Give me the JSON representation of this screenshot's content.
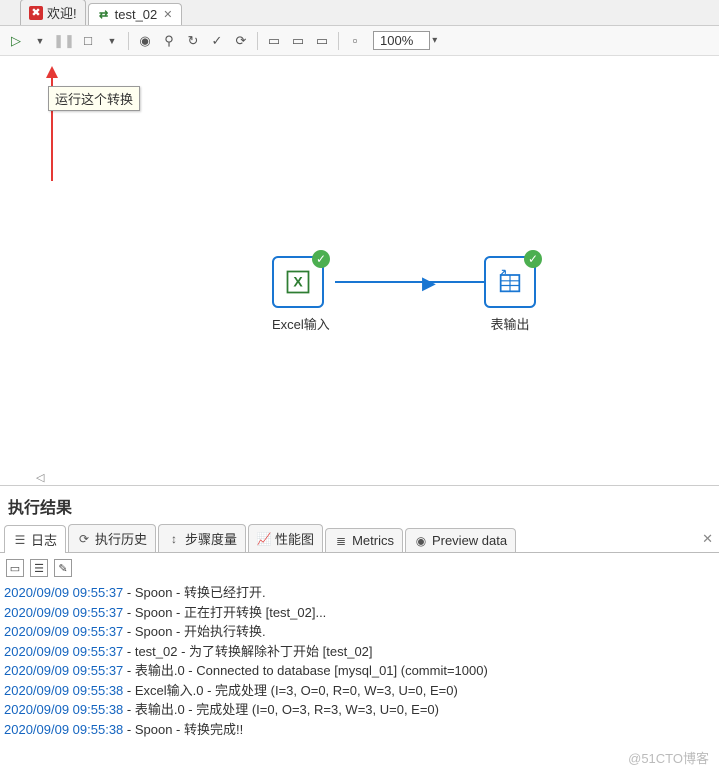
{
  "tabs": {
    "welcome": "欢迎!",
    "current": "test_02"
  },
  "toolbar": {
    "tooltip": "运行这个转换",
    "zoom": "100%"
  },
  "canvas": {
    "step1": "Excel输入",
    "step2": "表输出"
  },
  "results": {
    "title": "执行结果",
    "tabs": {
      "log": "日志",
      "history": "执行历史",
      "metrics_step": "步骤度量",
      "perf": "性能图",
      "metrics": "Metrics",
      "preview": "Preview data"
    }
  },
  "log": [
    {
      "ts": "2020/09/09 09:55:37",
      "msg": " - Spoon - 转换已经打开."
    },
    {
      "ts": "2020/09/09 09:55:37",
      "msg": " - Spoon - 正在打开转换 [test_02]..."
    },
    {
      "ts": "2020/09/09 09:55:37",
      "msg": " - Spoon - 开始执行转换."
    },
    {
      "ts": "2020/09/09 09:55:37",
      "msg": " - test_02 - 为了转换解除补丁开始  [test_02]"
    },
    {
      "ts": "2020/09/09 09:55:37",
      "msg": " - 表输出.0 - Connected to database [mysql_01] (commit=1000)"
    },
    {
      "ts": "2020/09/09 09:55:38",
      "msg": " - Excel输入.0 - 完成处理 (I=3, O=0, R=0, W=3, U=0, E=0)"
    },
    {
      "ts": "2020/09/09 09:55:38",
      "msg": " - 表输出.0 - 完成处理 (I=0, O=3, R=3, W=3, U=0, E=0)"
    },
    {
      "ts": "2020/09/09 09:55:38",
      "msg": " - Spoon - 转换完成!!"
    }
  ],
  "watermark": "@51CTO博客"
}
